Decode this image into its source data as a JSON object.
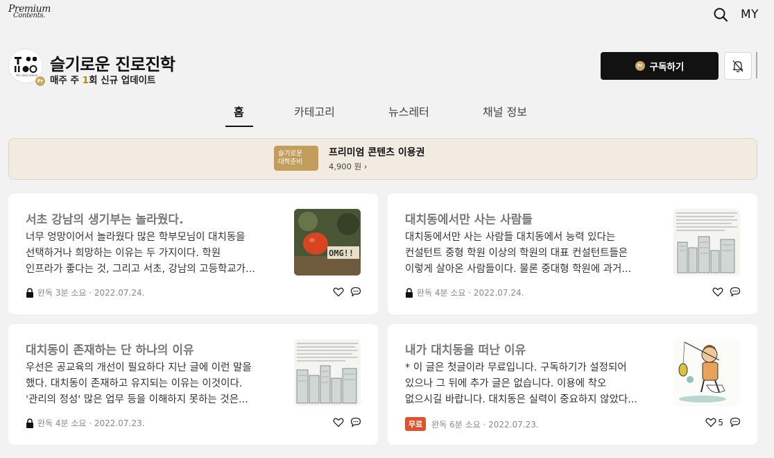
{
  "brand": {
    "line1": "Premium",
    "line2": "Contents."
  },
  "top_nav": {
    "my_label": "MY"
  },
  "channel": {
    "title": "슬기로운 진로진학",
    "subtitle_pre": "매주 주 ",
    "subtitle_num": "1",
    "subtitle_post": "회 신규 업데이트",
    "avatar_caption": "the class online",
    "badge": "Pr",
    "subscribe_label": "구독하기",
    "subscribe_badge": "Pr"
  },
  "tabs": [
    {
      "label": "홈",
      "active": true
    },
    {
      "label": "카테고리",
      "active": false
    },
    {
      "label": "뉴스레터",
      "active": false
    },
    {
      "label": "채널 정보",
      "active": false
    }
  ],
  "pass": {
    "thumb_line1": "슬기로운",
    "thumb_line2": "대학준비",
    "title": "프리미엄 콘텐츠 이용권",
    "price": "4,900 원 ›"
  },
  "articles": [
    {
      "title": "서초 강남의 생기부는 놀라웠다.",
      "excerpt": [
        "너무 엉망이어서 놀라웠다 많은 학부모님이 대치동을",
        "선택하거나 희망하는 이유는 두 가지이다. 학원",
        "인프라가 좋다는 것, 그리고 서초, 강남의 고등학교가..."
      ],
      "locked": true,
      "free_label": "",
      "meta": "완독 3분 소요 · 2022.07.24.",
      "likes": "",
      "thumb_text": "OMG!!"
    },
    {
      "title": "대치동에서만 사는 사람들",
      "excerpt": [
        "대치동에서만 사는 사람들 대치동에서 능력 있다는",
        "컨설턴트 중형 학원 이상의 학원의 대표 컨설턴트들은",
        "이렇게 살아온 사람들이다. 물론 중대형 학원에 과거..."
      ],
      "locked": true,
      "free_label": "",
      "meta": "완독 4분 소요 · 2022.07.24.",
      "likes": ""
    },
    {
      "title": "대치동이 존재하는 단 하나의 이유",
      "excerpt": [
        "우선은 공교육의 개선이 필요하다 지난 글에 이런 말을",
        "했다. 대치동이 존재하고 유지되는 이유는 이것이다.",
        "'관리의 정성' 많은 업무 등을 이해하지 못하는 것은..."
      ],
      "locked": true,
      "free_label": "",
      "meta": "완독 4분 소요 · 2022.07.23.",
      "likes": ""
    },
    {
      "title": "내가 대치동을 떠난 이유",
      "excerpt": [
        "* 이 글은 첫글이라 무료입니다. 구독하기가 설정되어",
        "있으나 그 뒤에 추가 글은 없습니다. 이용에 착오",
        "없으시길 바랍니다. 대치동은 실력이 중요하지 않았다..."
      ],
      "locked": false,
      "free_label": "무료",
      "meta": "완독 6분 소요 · 2022.07.23.",
      "likes": "5"
    }
  ],
  "colors": {
    "accent_gold": "#c9a55e",
    "free_red": "#e0512e",
    "dark_button": "#121212"
  }
}
